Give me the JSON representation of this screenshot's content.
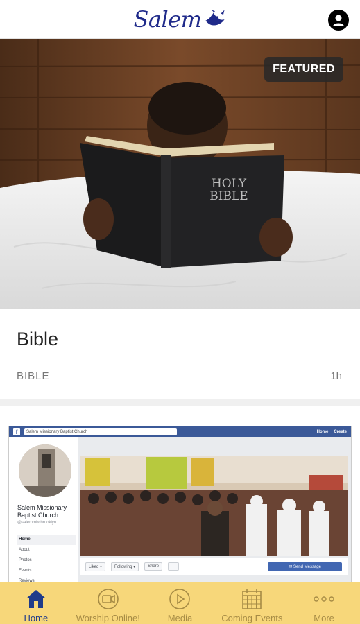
{
  "header": {
    "logo_text": "Salem",
    "logo_icon": "dove-icon",
    "profile_icon": "user-avatar-icon"
  },
  "featured_card": {
    "badge": "FEATURED",
    "bible_cover_text_line1": "HOLY",
    "bible_cover_text_line2": "BIBLE",
    "title": "Bible",
    "category": "BIBLE",
    "time": "1h"
  },
  "second_card": {
    "fb_search_text": "Salem Missionary Baptist Church",
    "fb_nav": [
      "Home",
      "Create"
    ],
    "page_name": "Salem Missionary Baptist Church",
    "page_handle": "@salemmbcbrooklyn",
    "menu_items": [
      "Home",
      "About",
      "Photos",
      "Events",
      "Reviews"
    ],
    "actions": [
      "Liked ▾",
      "Following ▾",
      "Share",
      "···"
    ],
    "send_message": "✉ Send Message"
  },
  "tabbar": {
    "tabs": [
      {
        "label": "Home",
        "icon": "home-icon",
        "active": true
      },
      {
        "label": "Worship Online!",
        "icon": "video-camera-icon",
        "active": false
      },
      {
        "label": "Media",
        "icon": "play-icon",
        "active": false
      },
      {
        "label": "Coming Events",
        "icon": "calendar-icon",
        "active": false
      },
      {
        "label": "More",
        "icon": "more-dots-icon",
        "active": false
      }
    ]
  },
  "colors": {
    "brand_blue": "#1f2a8a",
    "tabbar_bg": "#f7d77a",
    "tab_active": "#1f3b8a",
    "tab_inactive": "#a68b45"
  }
}
